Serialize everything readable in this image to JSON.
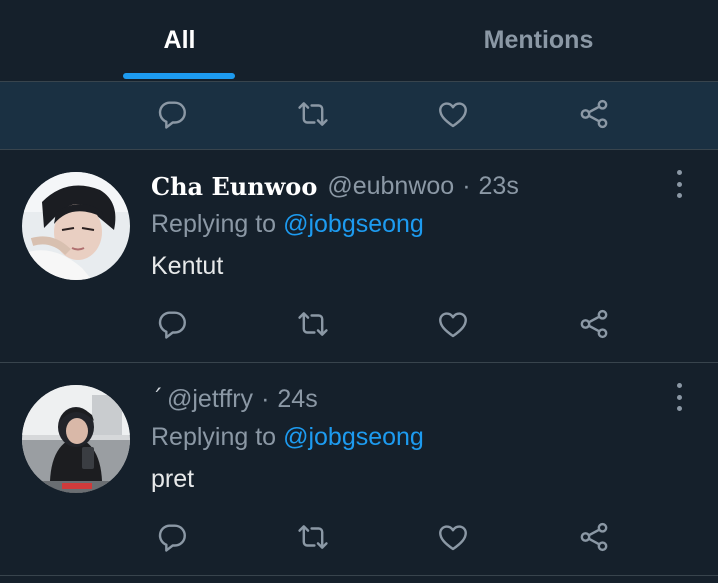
{
  "tabs": {
    "all": "All",
    "mentions": "Mentions",
    "active": "All"
  },
  "colors": {
    "background": "#15202b",
    "highlight_row": "#1a3042",
    "accent": "#1d9bf0",
    "secondary_text": "#8b98a5",
    "divider": "#38444d"
  },
  "icons": {
    "reply": "reply-icon",
    "retweet": "retweet-icon",
    "like": "heart-icon",
    "share": "share-icon",
    "more": "more-vertical-icon"
  },
  "tweets": [
    {
      "display_name": "Cha Eunwoo",
      "handle": "@eubnwoo",
      "separator": "·",
      "time": "23s",
      "replying_prefix": "Replying to",
      "replying_to": "@jobgseong",
      "text": "Kentut"
    },
    {
      "display_name": "´",
      "handle": "@jetffry",
      "separator": "·",
      "time": "24s",
      "replying_prefix": "Replying to",
      "replying_to": "@jobgseong",
      "text": "pret"
    }
  ]
}
